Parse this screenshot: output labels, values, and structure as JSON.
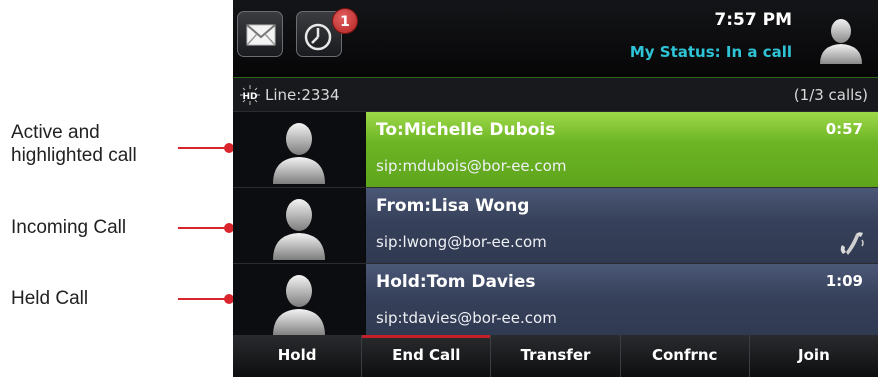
{
  "annotations": [
    {
      "label": "Active and\nhighlighted call"
    },
    {
      "label": "Incoming Call"
    },
    {
      "label": "Held Call"
    }
  ],
  "status_bar": {
    "icons": [
      {
        "name": "messages-icon"
      },
      {
        "name": "recent-calls-icon",
        "badge": "1"
      }
    ],
    "time": "7:57 PM",
    "my_status": "My Status: In a call"
  },
  "line_bar": {
    "line": "Line:2334",
    "calls_count": "(1/3 calls)"
  },
  "calls": [
    {
      "name": "To:Michelle Dubois",
      "sip": "sip:mdubois@bor-ee.com",
      "timer": "0:57",
      "state": "active"
    },
    {
      "name": "From:Lisa Wong",
      "sip": "sip:lwong@bor-ee.com",
      "timer": "",
      "state": "incoming"
    },
    {
      "name": "Hold:Tom Davies",
      "sip": "sip:tdavies@bor-ee.com",
      "timer": "1:09",
      "state": "held"
    }
  ],
  "softkeys": [
    "Hold",
    "End Call",
    "Transfer",
    "Confrnc",
    "Join"
  ],
  "colors": {
    "active_call": "#6db524",
    "inactive_call": "#36405a",
    "status_text": "#2ec4d6",
    "accent_red": "#d9262e"
  }
}
